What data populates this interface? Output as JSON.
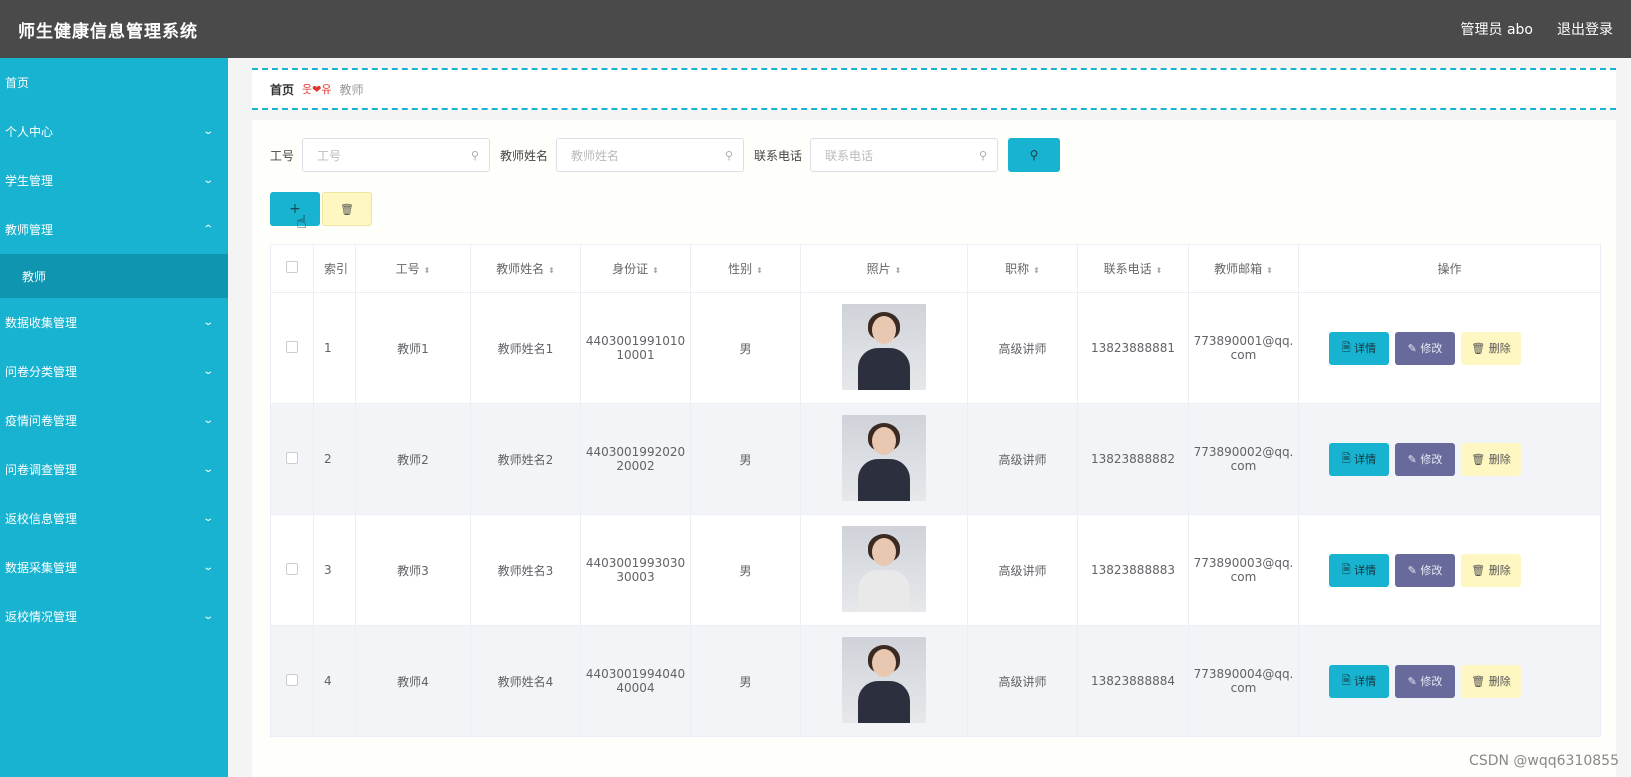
{
  "header": {
    "title": "师生健康信息管理系统",
    "user": "管理员 abo",
    "logout": "退出登录"
  },
  "sidebar": {
    "items": [
      {
        "label": "首页"
      },
      {
        "label": "个人中心"
      },
      {
        "label": "学生管理"
      },
      {
        "label": "教师管理"
      },
      {
        "label": "教师"
      },
      {
        "label": "数据收集管理"
      },
      {
        "label": "问卷分类管理"
      },
      {
        "label": "疫情问卷管理"
      },
      {
        "label": "问卷调查管理"
      },
      {
        "label": "返校信息管理"
      },
      {
        "label": "数据采集管理"
      },
      {
        "label": "返校情况管理"
      }
    ]
  },
  "breadcrumb": {
    "home": "首页",
    "sep": "웃❤유",
    "current": "教师"
  },
  "search": {
    "gonghao_label": "工号",
    "gonghao_placeholder": "工号",
    "name_label": "教师姓名",
    "name_placeholder": "教师姓名",
    "phone_label": "联系电话",
    "phone_placeholder": "联系电话"
  },
  "icons": {
    "chevron_down": "⌄",
    "chevron_up": "⌃",
    "search": "⚲",
    "add": "+",
    "trash": "🗑",
    "pointer": "☝",
    "detail": "🗎",
    "edit": "✎"
  },
  "table": {
    "headers": [
      "索引",
      "工号",
      "教师姓名",
      "身份证",
      "性别",
      "照片",
      "职称",
      "联系电话",
      "教师邮箱",
      "操作"
    ],
    "rows": [
      {
        "idx": "1",
        "gonghao": "教师1",
        "name": "教师姓名1",
        "id_a": "4403001991010",
        "id_b": "10001",
        "sex": "男",
        "title": "高级讲师",
        "phone": "13823888881",
        "mail_a": "773890001@qq.",
        "mail_b": "com"
      },
      {
        "idx": "2",
        "gonghao": "教师2",
        "name": "教师姓名2",
        "id_a": "4403001992020",
        "id_b": "20002",
        "sex": "男",
        "title": "高级讲师",
        "phone": "13823888882",
        "mail_a": "773890002@qq.",
        "mail_b": "com"
      },
      {
        "idx": "3",
        "gonghao": "教师3",
        "name": "教师姓名3",
        "id_a": "4403001993030",
        "id_b": "30003",
        "sex": "男",
        "title": "高级讲师",
        "phone": "13823888883",
        "mail_a": "773890003@qq.",
        "mail_b": "com"
      },
      {
        "idx": "4",
        "gonghao": "教师4",
        "name": "教师姓名4",
        "id_a": "4403001994040",
        "id_b": "40004",
        "sex": "男",
        "title": "高级讲师",
        "phone": "13823888884",
        "mail_a": "773890004@qq.",
        "mail_b": "com"
      }
    ],
    "btn_detail": "详情",
    "btn_edit": "修改",
    "btn_delete": "删除"
  },
  "watermark": "CSDN @wqq6310855",
  "colors": {
    "primary": "#17b3d0",
    "header": "#4a4a4a",
    "edit": "#676a9b",
    "warn": "#fff7c2"
  }
}
